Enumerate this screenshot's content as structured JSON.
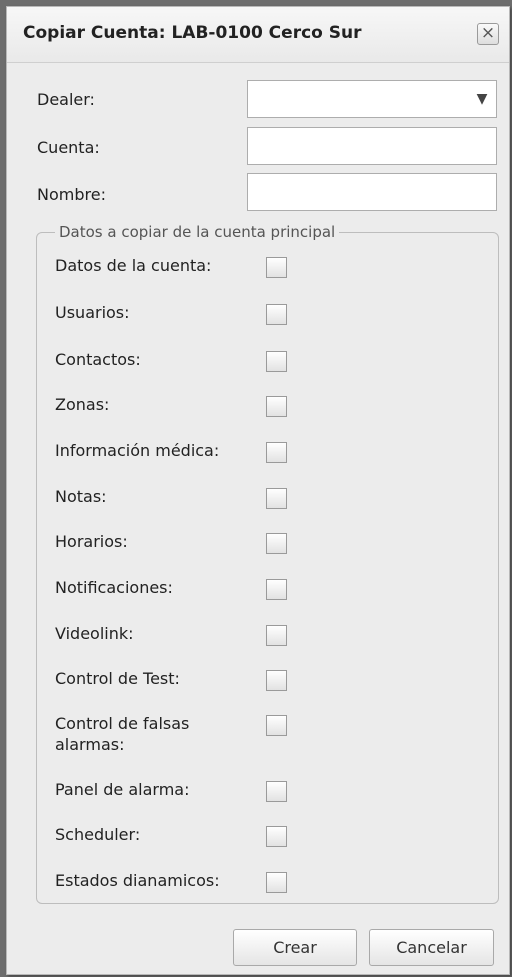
{
  "dialog": {
    "title": "Copiar Cuenta: LAB-0100 Cerco Sur",
    "close_icon": "×"
  },
  "form": {
    "dealer_label": "Dealer:",
    "dealer_value": "",
    "dealer_arrow": "▼",
    "cuenta_label": "Cuenta:",
    "cuenta_value": "",
    "nombre_label": "Nombre:",
    "nombre_value": ""
  },
  "copy_section": {
    "legend": "Datos a copiar de la cuenta principal",
    "items": [
      {
        "label": "Datos de la cuenta:",
        "checked": false
      },
      {
        "label": "Usuarios:",
        "checked": false
      },
      {
        "label": "Contactos:",
        "checked": false
      },
      {
        "label": "Zonas:",
        "checked": false
      },
      {
        "label": "Información médica:",
        "checked": false
      },
      {
        "label": "Notas:",
        "checked": false
      },
      {
        "label": "Horarios:",
        "checked": false
      },
      {
        "label": "Notificaciones:",
        "checked": false
      },
      {
        "label": "Videolink:",
        "checked": false
      },
      {
        "label": "Control de Test:",
        "checked": false
      },
      {
        "label": "Control de falsas alarmas:",
        "checked": false
      },
      {
        "label": "Panel de alarma:",
        "checked": false
      },
      {
        "label": "Scheduler:",
        "checked": false
      },
      {
        "label": "Estados dianamicos:",
        "checked": false
      }
    ]
  },
  "buttons": {
    "create": "Crear",
    "cancel": "Cancelar"
  }
}
